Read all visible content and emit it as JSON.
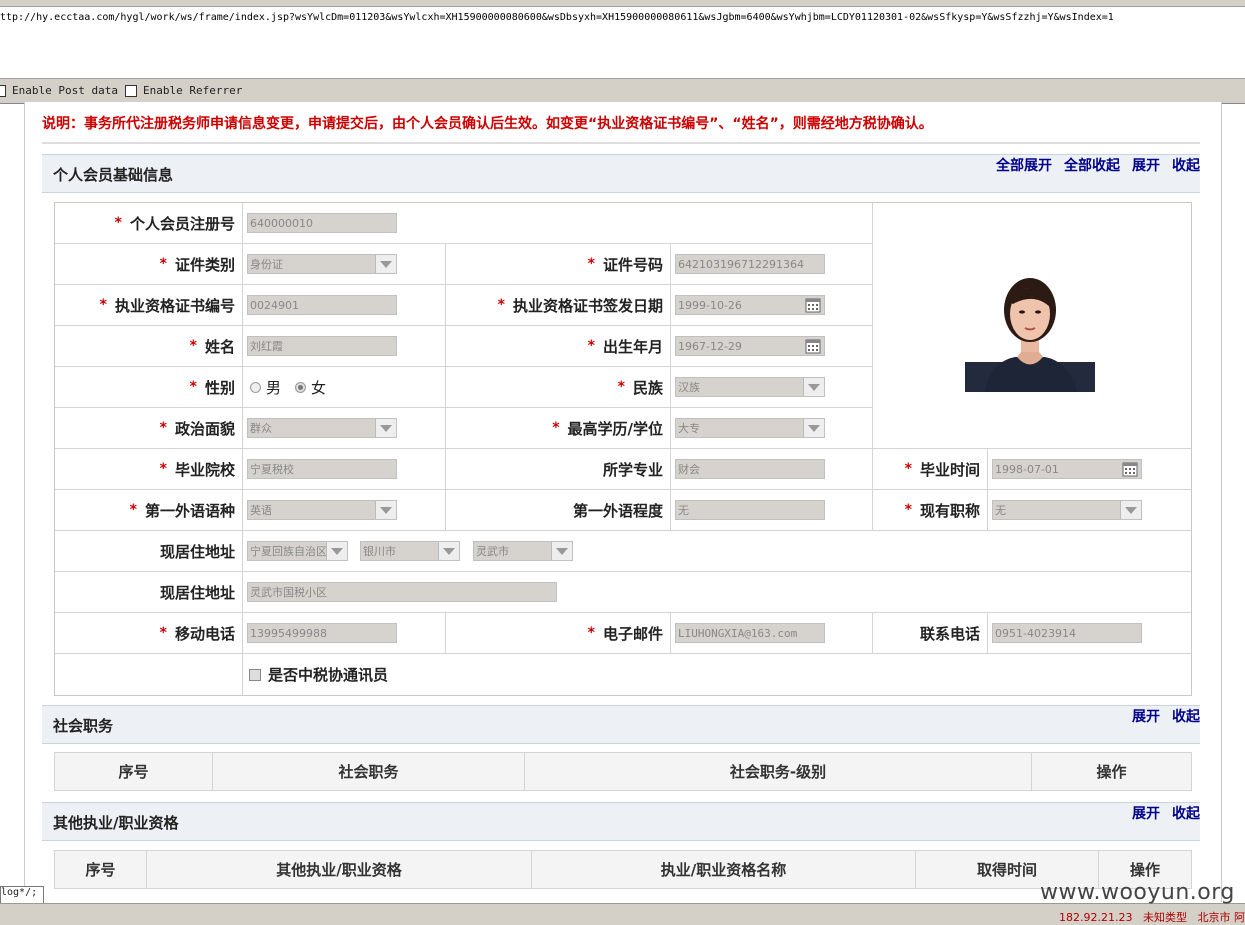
{
  "browser": {
    "url": "ttp://hy.ecctaa.com/hygl/work/ws/frame/index.jsp?wsYwlcDm=011203&wsYwlcxh=XH15900000080600&wsDbsyxh=XH15900000080611&wsJgbm=6400&wsYwhjbm=LCDY01120301-02&wsSfkysp=Y&wsSfzzhj=Y&wsIndex=1",
    "enable_post_label": "Enable Post data",
    "enable_referrer_label": "Enable Referrer",
    "status_box_text": "log*/;",
    "status_ip": "182.92.21.23",
    "status_type": "未知类型",
    "status_location": "北京市 阿"
  },
  "notice": "说明：事务所代注册税务师申请信息变更，申请提交后，由个人会员确认后生效。如变更“执业资格证书编号”、“姓名”，则需经地方税协确认。",
  "section_basic": {
    "title": "个人会员基础信息",
    "link_expand_all": "全部展开",
    "link_collapse_all": "全部收起",
    "link_expand": "展开",
    "link_collapse": "收起"
  },
  "form": {
    "reg_no_label": "个人会员注册号",
    "reg_no_value": "640000010",
    "id_type_label": "证件类别",
    "id_type_value": "身份证",
    "id_no_label": "证件号码",
    "id_no_value": "642103196712291364",
    "cert_no_label": "执业资格证书编号",
    "cert_no_value": "0024901",
    "cert_date_label": "执业资格证书签发日期",
    "cert_date_value": "1999-10-26",
    "name_label": "姓名",
    "name_value": "刘红霞",
    "birth_label": "出生年月",
    "birth_value": "1967-12-29",
    "gender_label": "性别",
    "gender_male": "男",
    "gender_female": "女",
    "ethnic_label": "民族",
    "ethnic_value": "汉族",
    "political_label": "政治面貌",
    "political_value": "群众",
    "education_label": "最高学历/学位",
    "education_value": "大专",
    "school_label": "毕业院校",
    "school_value": "宁夏税校",
    "major_label": "所学专业",
    "major_value": "财会",
    "grad_time_label": "毕业时间",
    "grad_time_value": "1998-07-01",
    "lang_label": "第一外语语种",
    "lang_value": "英语",
    "lang_level_label": "第一外语程度",
    "lang_level_value": "无",
    "title_label": "现有职称",
    "title_value": "无",
    "addr_label": "现居住地址",
    "addr_province": "宁夏回族自治区",
    "addr_city": "银川市",
    "addr_county": "灵武市",
    "addr2_label": "现居住地址",
    "addr2_value": "灵武市国税小区",
    "mobile_label": "移动电话",
    "mobile_value": "13995499988",
    "email_label": "电子邮件",
    "email_value": "LIUHONGXIA@163.com",
    "phone_label": "联系电话",
    "phone_value": "0951-4023914",
    "correspondent_label": "是否中税协通讯员"
  },
  "section_social": {
    "title": "社会职务",
    "link_expand": "展开",
    "link_collapse": "收起",
    "columns": [
      "序号",
      "社会职务",
      "社会职务-级别",
      "操作"
    ]
  },
  "section_other": {
    "title": "其他执业/职业资格",
    "link_expand": "展开",
    "link_collapse": "收起",
    "columns": [
      "序号",
      "其他执业/职业资格",
      "执业/职业资格名称",
      "取得时间",
      "操作"
    ]
  },
  "watermark": "www.wooyun.org"
}
